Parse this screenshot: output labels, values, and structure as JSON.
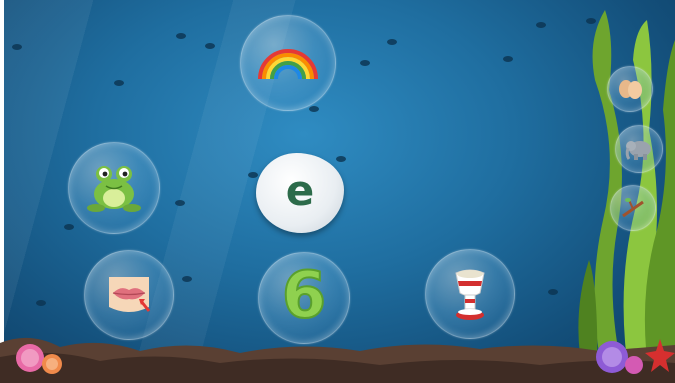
{
  "screen": {
    "name": "underwater-phonics-game"
  },
  "letter_card": {
    "letter": "e"
  },
  "number_card": {
    "value": "6"
  },
  "choices": [
    {
      "name": "rainbow",
      "icon": "rainbow-icon"
    },
    {
      "name": "frog",
      "icon": "frog-icon"
    },
    {
      "name": "lips",
      "icon": "lips-icon"
    },
    {
      "name": "number-six",
      "icon": "number-six-icon"
    },
    {
      "name": "egg-cup",
      "icon": "egg-cup-icon"
    }
  ],
  "side_items": [
    {
      "name": "eggs",
      "icon": "eggs-icon"
    },
    {
      "name": "elephant",
      "icon": "elephant-icon"
    },
    {
      "name": "branch",
      "icon": "branch-icon"
    }
  ],
  "colors": {
    "water": "#1f6ea0",
    "number": "#8fd14f",
    "letter": "#2c6b4a"
  }
}
